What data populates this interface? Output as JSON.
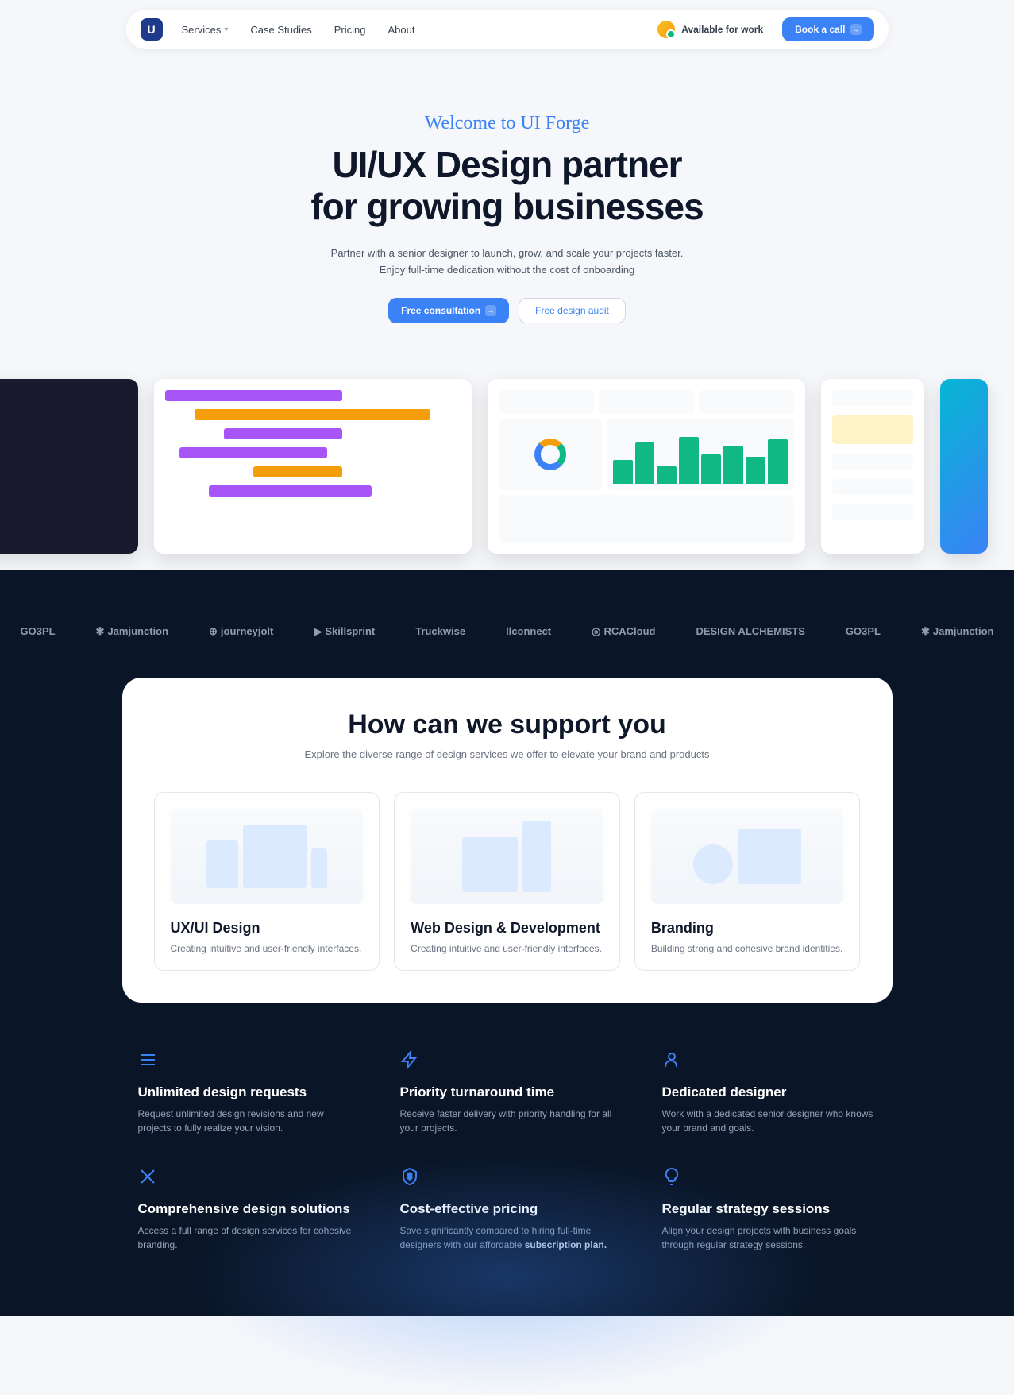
{
  "nav": {
    "services": "Services",
    "case_studies": "Case Studies",
    "pricing": "Pricing",
    "about": "About",
    "avail": "Available for work",
    "book": "Book a call"
  },
  "hero": {
    "welcome": "Welcome to UI Forge",
    "h1_line1": "UI/UX Design partner",
    "h1_line2": "for growing businesses",
    "sub1": "Partner with a senior designer to launch, grow, and scale your projects faster.",
    "sub2": "Enjoy full-time dedication without the cost of onboarding",
    "cta_primary": "Free consultation",
    "cta_secondary": "Free design audit"
  },
  "logos": [
    "GO3PL",
    "Jamjunction",
    "journeyjolt",
    "Skillsprint",
    "Truckwise",
    "llconnect",
    "RCACloud",
    "DESIGN ALCHEMISTS",
    "GO3PL",
    "Jamjunction"
  ],
  "support": {
    "title": "How can we support you",
    "sub": "Explore the diverse range of design services we offer to elevate your brand and products",
    "cards": [
      {
        "title": "UX/UI Design",
        "desc": "Creating intuitive and user-friendly interfaces."
      },
      {
        "title": "Web Design & Development",
        "desc": "Creating intuitive and user-friendly interfaces."
      },
      {
        "title": "Branding",
        "desc": "Building strong and cohesive brand identities."
      }
    ]
  },
  "features": [
    {
      "title": "Unlimited design requests",
      "desc": "Request unlimited design revisions and new projects to fully realize your vision."
    },
    {
      "title": "Priority turnaround time",
      "desc": "Receive faster delivery with priority handling for all your projects."
    },
    {
      "title": "Dedicated designer",
      "desc": "Work with a dedicated senior designer who knows your brand and goals."
    },
    {
      "title": "Comprehensive design solutions",
      "desc": "Access a full range of design services for cohesive branding."
    },
    {
      "title": "Cost-effective pricing",
      "desc": "Save significantly compared to hiring full-time designers with our affordable ",
      "em": "subscription plan."
    },
    {
      "title": "Regular strategy sessions",
      "desc": "Align your design projects with business goals through regular strategy sessions."
    }
  ]
}
